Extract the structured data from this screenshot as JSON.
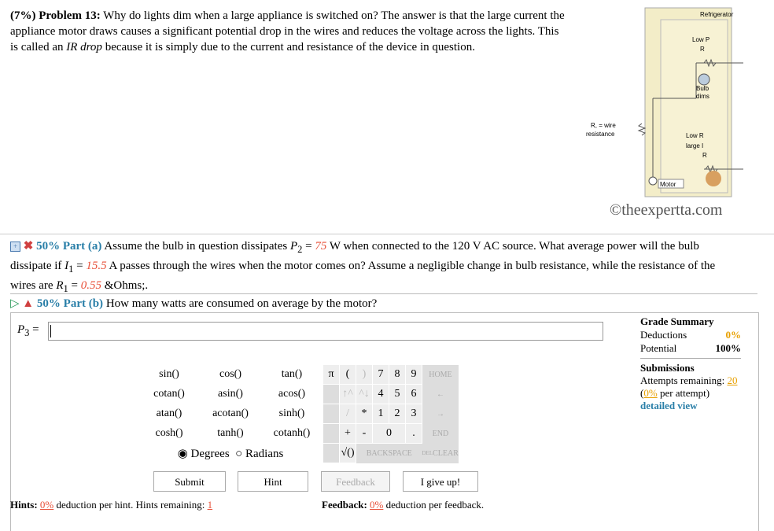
{
  "problem": {
    "header": "(7%) Problem 13:",
    "text_1": " Why do lights dim when a large appliance is switched on? The answer is that the large current the appliance motor draws causes a significant potential drop in the wires and reduces the voltage across the lights. This is called an ",
    "ir_drop": "IR drop",
    "text_2": " because it is simply due to the current and resistance of the device in question."
  },
  "diagram": {
    "refrigerator": "Refrigerator",
    "low_p2": "Low P",
    "r2": "R",
    "bulb": "Bulb",
    "dims": "dims",
    "r1_wire": "R, = wire",
    "resistance": "resistance",
    "low_r3": "Low R",
    "large_i3": "large I",
    "r3": "R",
    "motor": "Motor",
    "credit": "©theexpertta.com"
  },
  "part_a": {
    "label": "50% Part (a)",
    "t1": " Assume the bulb in question dissipates ",
    "p2": "P",
    "t2": " = ",
    "p2_val": "75",
    "t3": " W when connected to the 120 V AC source. What average power will the bulb dissipate if ",
    "i1": "I",
    "t4": " = ",
    "i1_val": "15.5",
    "t5": " A passes through the wires when the motor comes on? Assume a negligible change in bulb resistance, while the resistance of the wires are ",
    "r1": "R",
    "t6": " = ",
    "r1_val": "0.55",
    "t7": " &Ohms;."
  },
  "part_b": {
    "label": "50% Part (b)",
    "question": " How many watts are consumed on average by the motor?",
    "answer_label": "P",
    "answer_sub": "3",
    "answer_eq": " ="
  },
  "calculator": {
    "functions": [
      [
        "sin()",
        "cos()",
        "tan()"
      ],
      [
        "cotan()",
        "asin()",
        "acos()"
      ],
      [
        "atan()",
        "acotan()",
        "sinh()"
      ],
      [
        "cosh()",
        "tanh()",
        "cotanh()"
      ]
    ],
    "pi": "π",
    "lparen": "(",
    "rparen": ")",
    "up": "↑^",
    "upbar": "^↓",
    "slash": "/",
    "star": "*",
    "plus": "+",
    "minus": "-",
    "sqrt": "√()",
    "digits": [
      "7",
      "8",
      "9",
      "4",
      "5",
      "6",
      "1",
      "2",
      "3",
      "0",
      "."
    ],
    "home": "HOME",
    "left": "←",
    "right": "→",
    "end": "END",
    "backspace": "BACKSPACE",
    "del": "DEL",
    "clear": "CLEAR",
    "degrees": "Degrees",
    "radians": "Radians"
  },
  "buttons": {
    "submit": "Submit",
    "hint": "Hint",
    "feedback": "Feedback",
    "give_up": "I give up!"
  },
  "hints": {
    "label": "Hints:",
    "pct": "0%",
    "text": " deduction per hint. Hints remaining: ",
    "remaining": "1"
  },
  "feedback": {
    "label": "Feedback:",
    "pct": "0%",
    "text": " deduction per feedback."
  },
  "grade": {
    "title": "Grade Summary",
    "deductions_label": "Deductions",
    "deductions": "0%",
    "potential_label": "Potential",
    "potential": "100%",
    "submissions_title": "Submissions",
    "attempts_label": "Attempts remaining: ",
    "attempts": "20",
    "per_attempt_pre": "(",
    "per_attempt_pct": "0%",
    "per_attempt_post": " per attempt)",
    "detailed": "detailed view"
  }
}
